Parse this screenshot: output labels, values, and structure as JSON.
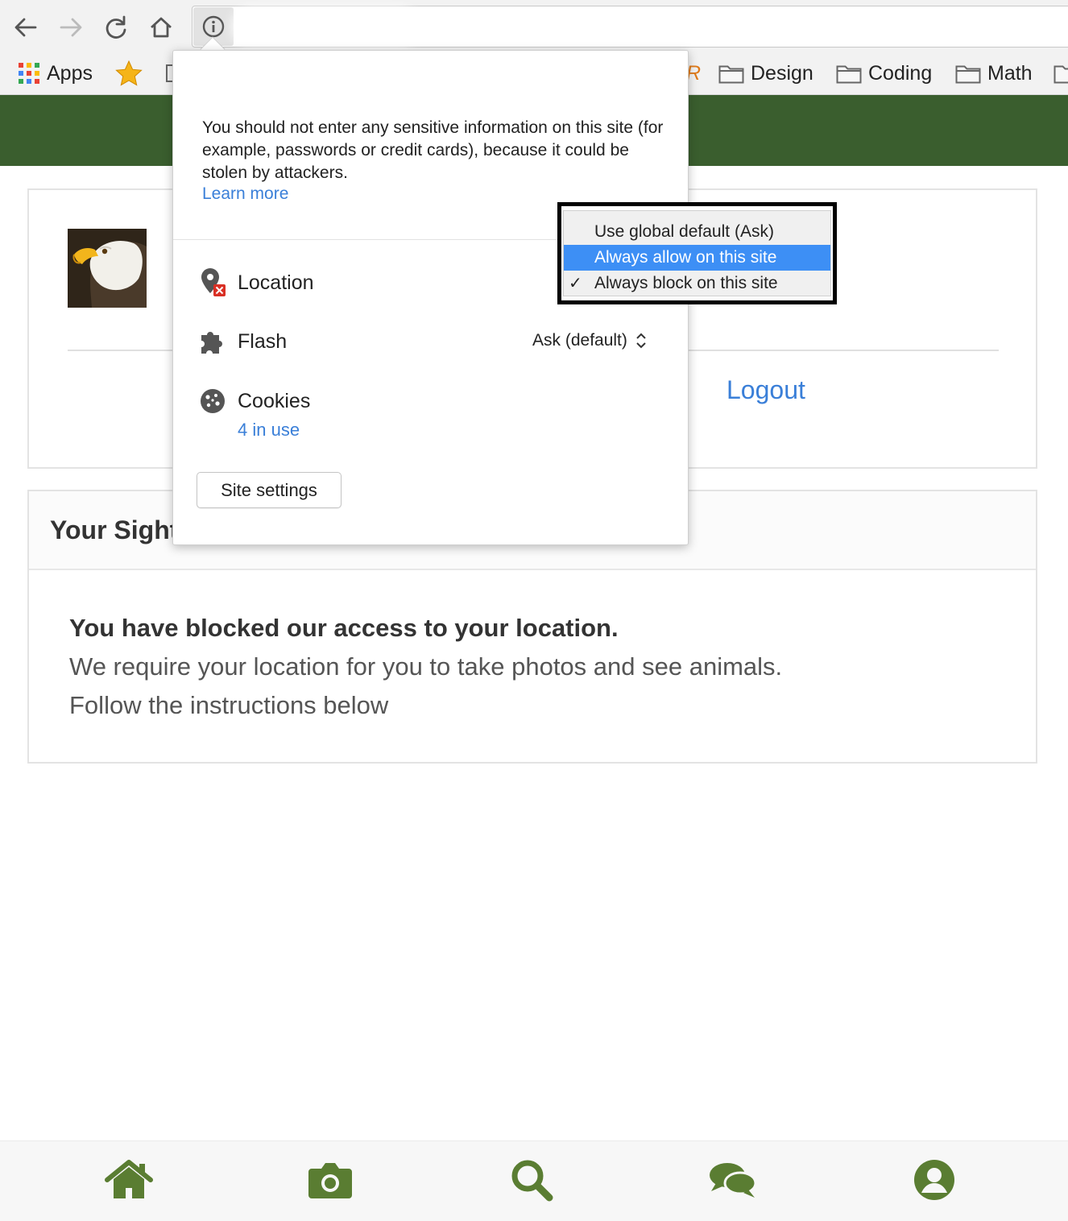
{
  "browser": {
    "nav": {
      "back_icon": "arrow-left-icon",
      "forward_icon": "arrow-right-icon",
      "reload_icon": "reload-icon",
      "home_icon": "home-icon",
      "site_info_icon": "info-circle-icon"
    }
  },
  "bookmarks": {
    "items": [
      {
        "label": "Apps",
        "icon": "apps-grid-icon"
      },
      {
        "label": "",
        "icon": "star-icon"
      },
      {
        "label": "R",
        "icon": "text-fragment"
      },
      {
        "label": "Design",
        "icon": "folder-icon"
      },
      {
        "label": "Coding",
        "icon": "folder-icon"
      },
      {
        "label": "Math",
        "icon": "folder-icon"
      }
    ]
  },
  "page": {
    "header_color": "#3a5e2e",
    "logout": "Logout",
    "sightings_title": "Your Sightings",
    "blocked_title": "You have blocked our access to your location.",
    "blocked_line1": "We require your location for you to take photos and see animals.",
    "blocked_line2": "Follow the instructions below"
  },
  "popup": {
    "warning": "You should not enter any sensitive information on this site (for example, passwords or credit cards), because it could be stolen by attackers.",
    "learn_more": "Learn more",
    "permissions": {
      "location": {
        "label": "Location",
        "icon": "location-blocked-icon"
      },
      "flash": {
        "label": "Flash",
        "value": "Ask (default)",
        "icon": "puzzle-piece-icon"
      },
      "cookies": {
        "label": "Cookies",
        "count": "4 in use",
        "icon": "cookie-icon"
      }
    },
    "site_settings": "Site settings"
  },
  "location_dropdown": {
    "options": [
      {
        "label": "Use global default (Ask)",
        "highlighted": false,
        "checked": false
      },
      {
        "label": "Always allow on this site",
        "highlighted": true,
        "checked": false
      },
      {
        "label": "Always block on this site",
        "highlighted": false,
        "checked": true
      }
    ],
    "check_mark": "✓",
    "highlight_color": "#3d8ff5"
  },
  "bottom_nav": {
    "color": "#5a7d32",
    "items": [
      "home-icon",
      "camera-icon",
      "search-icon",
      "chat-icon",
      "user-icon"
    ]
  }
}
